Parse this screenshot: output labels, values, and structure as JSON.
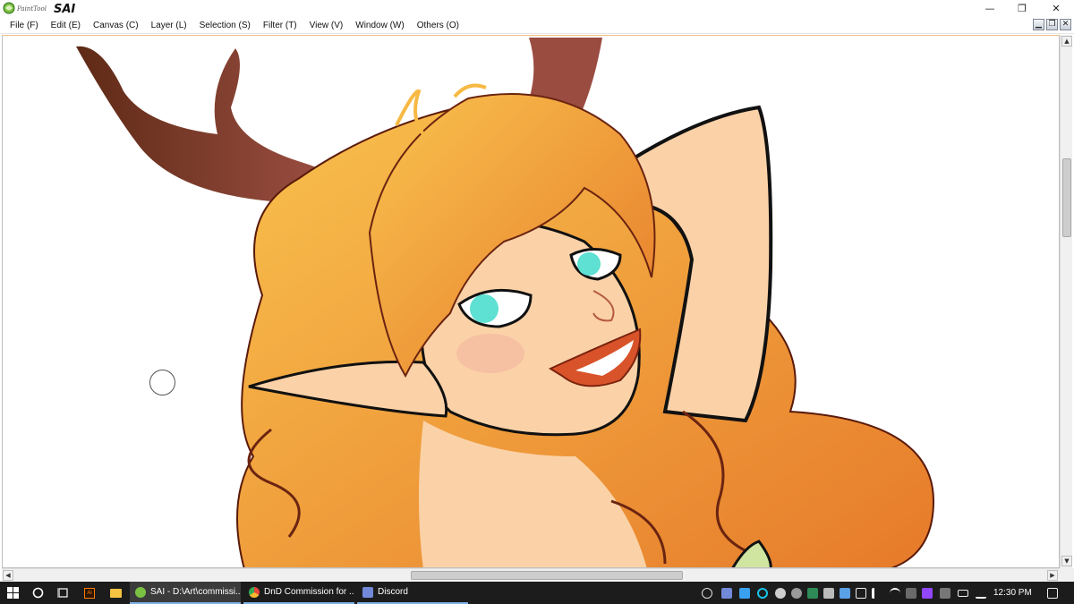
{
  "titlebar": {
    "logo_small": "PaintTool",
    "logo_big": "SAI",
    "minimize": "—",
    "restore": "❐",
    "close": "✕"
  },
  "menu": [
    {
      "label": "File (F)"
    },
    {
      "label": "Edit (E)"
    },
    {
      "label": "Canvas (C)"
    },
    {
      "label": "Layer (L)"
    },
    {
      "label": "Selection (S)"
    },
    {
      "label": "Filter (T)"
    },
    {
      "label": "View (V)"
    },
    {
      "label": "Window (W)"
    },
    {
      "label": "Others (O)"
    }
  ],
  "mdi": {
    "minimize": "▁",
    "restore": "❐",
    "close": "✕"
  },
  "scroll": {
    "up": "▲",
    "down": "▼",
    "left": "◀",
    "right": "▶"
  },
  "taskbar": {
    "tasks": [
      {
        "label": "SAI - D:\\Art\\commissi...",
        "icon_color": "#7ac142"
      },
      {
        "label": "DnD Commission for ...",
        "icon_color": "#e8453c"
      },
      {
        "label": "Discord",
        "icon_color": "#7289da"
      }
    ],
    "pinned": [
      {
        "name": "windows-start",
        "color": "#ffffff"
      },
      {
        "name": "cortana",
        "color": "#ffffff"
      },
      {
        "name": "task-view",
        "color": "#ffffff"
      },
      {
        "name": "illustrator",
        "color": "#ff7c00"
      },
      {
        "name": "file-explorer",
        "color": "#f5c242"
      }
    ],
    "clock": "12:30 PM"
  },
  "colors": {
    "hair_light": "#f7b944",
    "hair_dark": "#e2782a",
    "skin": "#fbd2a8",
    "antler": "#6b2f1a",
    "eye": "#5ee0d2",
    "lips": "#d8532a",
    "taskbar_bg": "#1c1c1c",
    "accent": "#7fb2e6"
  }
}
